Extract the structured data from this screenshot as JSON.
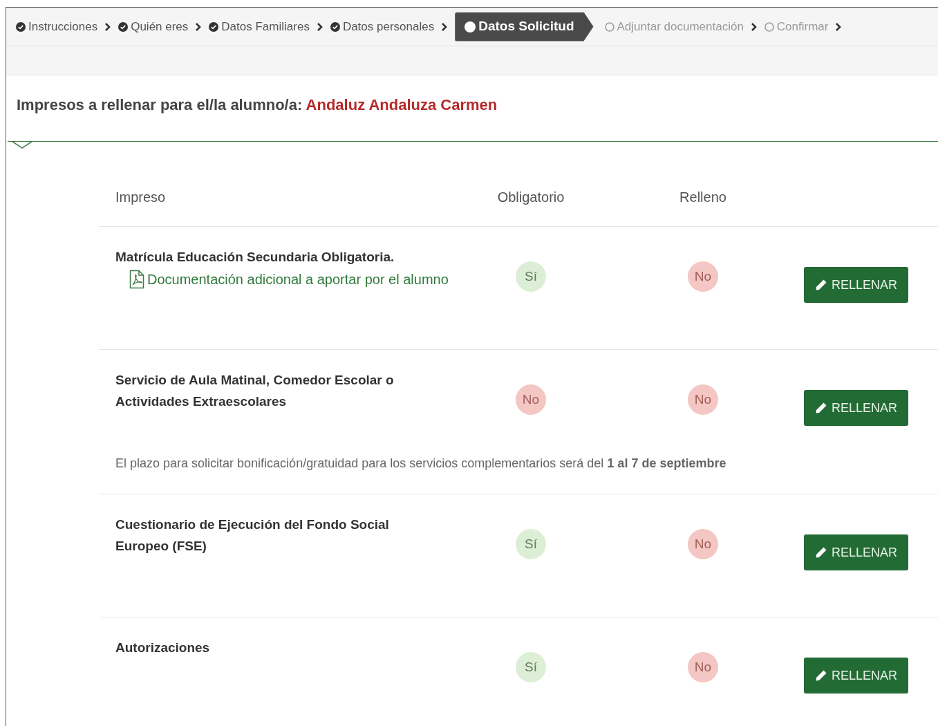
{
  "steps": [
    {
      "label": "Instrucciones",
      "completed": true,
      "selected": false
    },
    {
      "label": "Quién eres",
      "completed": true,
      "selected": false
    },
    {
      "label": "Datos Familiares",
      "completed": true,
      "selected": false
    },
    {
      "label": "Datos personales",
      "completed": true,
      "selected": false
    },
    {
      "label": "Datos Solicitud",
      "selected": true
    },
    {
      "label": "Adjuntar documentación",
      "completed": false,
      "selected": false
    },
    {
      "label": "Confirmar",
      "completed": false,
      "selected": false
    }
  ],
  "heading": {
    "prefix": "Impresos a rellenar para el/la alumno/a:",
    "student": "Andaluz Andaluza Carmen"
  },
  "table": {
    "columns": [
      "Impreso",
      "Obligatorio",
      "Relleno"
    ],
    "rows": [
      {
        "kind": "form",
        "name": "Matrícula Educación Secundaria Obligatoria.",
        "document_link": "Documentación adicional a aportar por el alumno",
        "obligatorio": {
          "text": "Sí",
          "positive": true
        },
        "relleno": {
          "text": "No",
          "positive": false
        },
        "button": "RELLENAR"
      },
      {
        "kind": "form",
        "name": "Servicio de Aula Matinal, Comedor Escolar o Actividades Extraescolares",
        "obligatorio": {
          "text": "No",
          "positive": false
        },
        "relleno": {
          "text": "No",
          "positive": false
        },
        "button": "RELLENAR"
      },
      {
        "kind": "note",
        "text": "El plazo para solicitar bonificación/gratuidad para los servicios complementarios será del **1 al 7 de septiembre**"
      },
      {
        "kind": "form",
        "name": "Cuestionario de Ejecución del Fondo Social Europeo (FSE)",
        "obligatorio": {
          "text": "Sí",
          "positive": true
        },
        "relleno": {
          "text": "No",
          "positive": false
        },
        "button": "RELLENAR"
      },
      {
        "kind": "form",
        "name": "Autorizaciones",
        "obligatorio": {
          "text": "Sí",
          "positive": true
        },
        "relleno": {
          "text": "No",
          "positive": false
        },
        "button": "RELLENAR"
      }
    ]
  }
}
